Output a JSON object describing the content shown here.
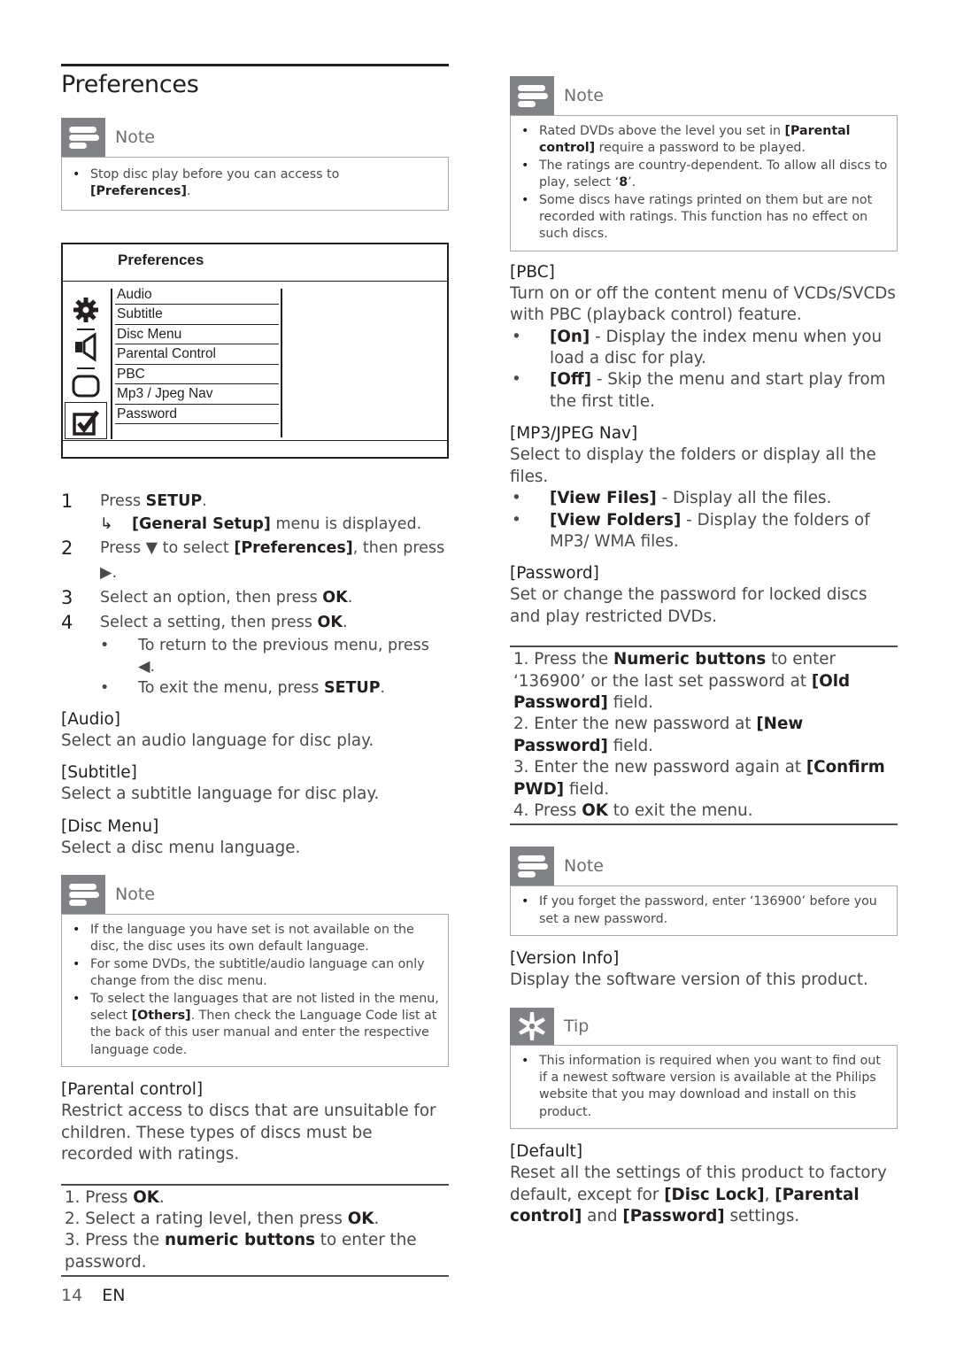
{
  "left": {
    "title": "Preferences",
    "note1": {
      "label": "Note",
      "items": [
        {
          "pre": "Stop disc play before you can access to ",
          "bold": "[Preferences]",
          "post": "."
        }
      ]
    },
    "menu": {
      "title": "Preferences",
      "items": [
        "Audio",
        "Subtitle",
        "Disc Menu",
        "Parental Control",
        "PBC",
        "Mp3 / Jpeg Nav",
        "Password"
      ],
      "icons": [
        "gear-icon",
        "speaker-icon",
        "rounded-rect-icon",
        "checkbox-icon"
      ],
      "selected_icon": "checkbox-icon"
    },
    "steps": [
      {
        "num": "1",
        "pre": "Press ",
        "bold": "SETUP",
        "post": "."
      },
      {
        "num": "2",
        "pre": "Press ▼ to select ",
        "bold": "[Preferences]",
        "post": ", then press ▶."
      },
      {
        "num": "3",
        "pre": "Select an option, then press ",
        "bold": "OK",
        "post": "."
      },
      {
        "num": "4",
        "pre": "Select a setting, then press ",
        "bold": "OK",
        "post": "."
      }
    ],
    "step1_result": {
      "arrow": "↳",
      "bold": "[General Setup]",
      "post": " menu is displayed."
    },
    "step4_bullets": [
      {
        "pre": "To return to the previous menu, press ◀.",
        "bold": "",
        "post": ""
      },
      {
        "pre": "To exit the menu, press ",
        "bold": "SETUP",
        "post": "."
      }
    ],
    "sections": [
      {
        "head": "[Audio]",
        "text": "Select an audio language for disc play."
      },
      {
        "head": "[Subtitle]",
        "text": "Select a subtitle language for disc play."
      },
      {
        "head": "[Disc Menu]",
        "text": "Select a disc menu language."
      }
    ],
    "note2": {
      "label": "Note",
      "items": [
        {
          "pre": "If the language you have set is not available on the disc, the disc uses its own default language.",
          "bold": "",
          "post": ""
        },
        {
          "pre": "For some DVDs, the subtitle/audio language can only change from the disc menu.",
          "bold": "",
          "post": ""
        },
        {
          "pre": "To select the languages that are not listed in the menu, select ",
          "bold": "[Others]",
          "post": ". Then check the Language Code list at the back of this user manual and enter the respective language code."
        }
      ]
    },
    "parental": {
      "head": "[Parental control]",
      "text": "Restrict access to discs that are unsuitable for children. These types of discs must be recorded with ratings.",
      "procedure": [
        {
          "pre": "1. Press ",
          "bold": "OK",
          "post": "."
        },
        {
          "pre": "2. Select a rating level, then press ",
          "bold": "OK",
          "post": "."
        },
        {
          "pre": "3. Press the ",
          "bold": "numeric buttons",
          "post": " to enter the password."
        }
      ]
    }
  },
  "right": {
    "note3": {
      "label": "Note",
      "items": [
        {
          "pre": "Rated DVDs above the level you set in ",
          "bold": "[Parental control]",
          "post": " require a password to be played."
        },
        {
          "pre": "The ratings are country-dependent. To allow all discs to play, select ‘",
          "bold": "8",
          "post": "’."
        },
        {
          "pre": "Some discs have ratings printed on them but are not recorded with ratings. This function has no effect on such discs.",
          "bold": "",
          "post": ""
        }
      ]
    },
    "pbc": {
      "head": "[PBC]",
      "text": "Turn on or off the content menu of VCDs/SVCDs with PBC (playback control) feature.",
      "bullets": [
        {
          "bold": "[On]",
          "post": " - Display the index menu when you load a disc for play."
        },
        {
          "bold": "[Off]",
          "post": " - Skip the menu and start play from the first title."
        }
      ]
    },
    "mp3": {
      "head": "[MP3/JPEG Nav]",
      "text": "Select to display the folders or display all the files.",
      "bullets": [
        {
          "bold": "[View Files]",
          "post": " - Display all the files."
        },
        {
          "bold": "[View Folders]",
          "post": " - Display the folders of MP3/ WMA files."
        }
      ]
    },
    "password": {
      "head": "[Password]",
      "text": "Set or change the password for locked discs and play restricted DVDs.",
      "procedure": [
        {
          "pre": "1. Press the ",
          "bold": "Numeric buttons",
          "post": " to enter ‘136900’ or the last set password at ",
          "bold2": "[Old Password]",
          "post2": " field."
        },
        {
          "pre": "2. Enter the new password at ",
          "bold": "[New Password]",
          "post": " field.",
          "bold2": "",
          "post2": ""
        },
        {
          "pre": "3. Enter the new password again at ",
          "bold": "[Confirm PWD]",
          "post": " field.",
          "bold2": "",
          "post2": ""
        },
        {
          "pre": "4. Press ",
          "bold": "OK",
          "post": " to exit the menu.",
          "bold2": "",
          "post2": ""
        }
      ]
    },
    "note4": {
      "label": "Note",
      "items": [
        {
          "pre": "If you forget the password, enter ‘136900’ before you set a new password.",
          "bold": "",
          "post": ""
        }
      ]
    },
    "version": {
      "head": "[Version Info]",
      "text": "Display the software version of this product."
    },
    "tip": {
      "label": "Tip",
      "items": [
        {
          "pre": "This information is required when you want to find out if a newest software version is available at the Philips website that you may download and install on this product.",
          "bold": "",
          "post": ""
        }
      ]
    },
    "default": {
      "head": "[Default]",
      "pre": "Reset all the settings of this product to factory default, except for ",
      "b1": "[Disc Lock]",
      "m1": ", ",
      "b2": "[Parental control]",
      "m2": " and ",
      "b3": "[Password]",
      "post": " settings."
    }
  },
  "footer": {
    "page_number": "14",
    "language": "EN"
  }
}
